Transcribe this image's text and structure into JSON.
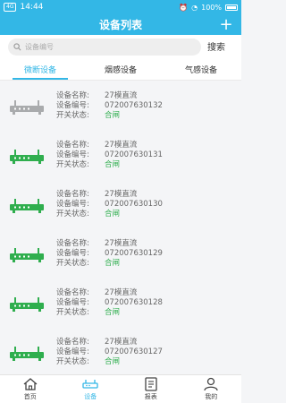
{
  "status": {
    "time": "14:44",
    "speed": "0.50\nKB/s",
    "battery": "100%",
    "sim": "4G"
  },
  "header": {
    "title": "设备列表",
    "add": "+"
  },
  "search": {
    "placeholder": "设备编号",
    "button": "搜索"
  },
  "tabs": [
    {
      "label": "微断设备",
      "active": true
    },
    {
      "label": "烟感设备",
      "active": false
    },
    {
      "label": "气感设备",
      "active": false
    }
  ],
  "labels": {
    "name": "设备名称:",
    "code": "设备编号:",
    "state": "开关状态:"
  },
  "devices": [
    {
      "name": "27模直流",
      "code": "072007630132",
      "state": "合闸",
      "online": false
    },
    {
      "name": "27模直流",
      "code": "072007630131",
      "state": "合闸",
      "online": true
    },
    {
      "name": "27模直流",
      "code": "072007630130",
      "state": "合闸",
      "online": true
    },
    {
      "name": "27模直流",
      "code": "072007630129",
      "state": "合闸",
      "online": true
    },
    {
      "name": "27模直流",
      "code": "072007630128",
      "state": "合闸",
      "online": true
    },
    {
      "name": "27模直流",
      "code": "072007630127",
      "state": "合闸",
      "online": true
    }
  ],
  "colors": {
    "accent": "#33b7e6",
    "online": "#2fae4e",
    "offline": "#a9abad"
  },
  "nav": [
    {
      "label": "首页",
      "icon": "home-icon",
      "active": false
    },
    {
      "label": "设备",
      "icon": "device-icon",
      "active": true
    },
    {
      "label": "报表",
      "icon": "report-icon",
      "active": false
    },
    {
      "label": "我的",
      "icon": "user-icon",
      "active": false
    }
  ]
}
